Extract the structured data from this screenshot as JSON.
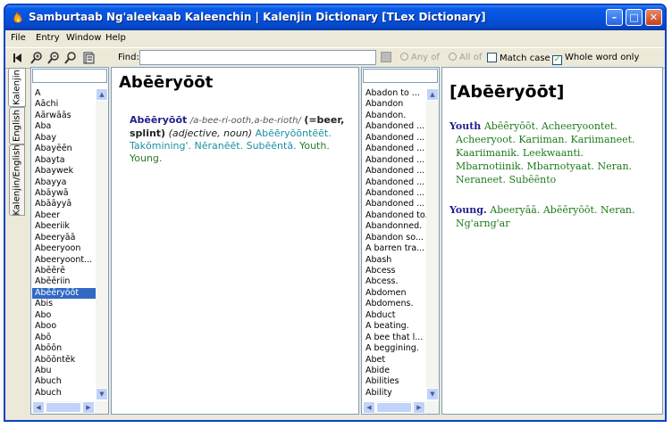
{
  "window": {
    "title": "Samburtaab Ng'aleekaab Kaleenchin | Kalenjin Dictionary [TLex Dictionary]",
    "min_glyph": "–",
    "max_glyph": "□",
    "close_glyph": "✕"
  },
  "menu": [
    "File",
    "Entry",
    "Window",
    "Help"
  ],
  "toolbar": {
    "find_label": "Find:",
    "find_value": "",
    "any_of": "Any of",
    "all_of": "All of",
    "match_case": "Match case",
    "whole_word": "Whole word only",
    "match_case_checked": false,
    "whole_word_checked": true
  },
  "tabs": [
    "Kalenjin",
    "English",
    "Kalenjin/English"
  ],
  "left_list": {
    "items": [
      "A",
      "Aāchi",
      "Aārwāās",
      "Aba",
      "Abay",
      "Abayēēn",
      "Abayta",
      "Abaywek",
      "Abayya",
      "Abāywā",
      "Abāāyyā",
      "Abeer",
      "Abeeriik",
      "Abeeryāā",
      "Abeeryoon",
      "Abeeryoont...",
      "Abēērē",
      "Abēēriin",
      "Abēēryōōt",
      "Abis",
      "Abo",
      "Aboo",
      "Abō",
      "Abōōn",
      "Abōōntēk",
      "Abu",
      "Abuch",
      "Abuch"
    ],
    "selected_index": 18
  },
  "entry": {
    "title": "Abēēryōōt",
    "headword": "Abēēryōōt",
    "pron": "/a-bee-ri-ooth,a-be-rioth/",
    "gloss": "(=beer, splint)",
    "pos": "(adjective, noun)",
    "forms": "Abēēryōōntēēt. Takōmining'. Nēranēēt. Subēēntā.",
    "trans": "Youth. Young."
  },
  "right_list": {
    "items": [
      "Abadon to ...",
      "Abandon",
      "Abandon.",
      "Abandoned ...",
      "Abandoned ...",
      "Abandoned ...",
      "Abandoned ...",
      "Abandoned ...",
      "Abandoned ...",
      "Abandoned ...",
      "Abandoned ...",
      "Abandoned to.",
      "Abandonned.",
      "Abandon so...",
      "A barren tra...",
      "Abash",
      "Abcess",
      "Abcess.",
      "Abdomen",
      "Abdomens.",
      "Abduct",
      "A beating.",
      "A bee that l...",
      "A beggining.",
      "Abet",
      "Abide",
      "Abilities",
      "Ability"
    ]
  },
  "reverse": {
    "title": "[Abēēryōōt]",
    "senses": [
      {
        "head": "Youth",
        "first": "Abēēryōōt. Acheeryoontet.",
        "rest": "Acheeryoot. Kariiman. Kariimaneet. Kaariimanik. Leekwaanti. Mbarnotiinik. Mbarnotyaat. Neran. Neraneet. Subēēnto"
      },
      {
        "head": "Young.",
        "first": "Abeeryāā. Abēēryōōt. Neran.",
        "rest": "Ng'arng'ar"
      }
    ]
  },
  "icons": [
    "flame-icon",
    "back-arrow-icon",
    "zoom-in-icon",
    "zoom-out-icon",
    "search-icon",
    "page-icon"
  ]
}
